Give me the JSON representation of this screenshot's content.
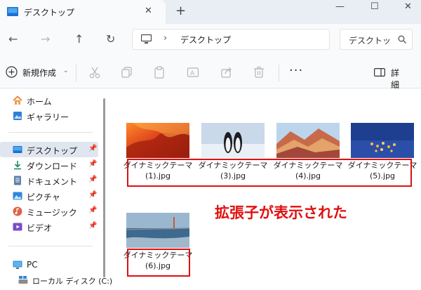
{
  "tab": {
    "title": "デスクトップ",
    "close": "✕",
    "add": "+"
  },
  "window_controls": {
    "minimize": "—",
    "maximize": "☐",
    "close": "✕"
  },
  "nav": {
    "back": "←",
    "forward": "→",
    "up": "↑",
    "refresh": "↻"
  },
  "address": {
    "separator": "›",
    "path": "デスクトップ"
  },
  "search": {
    "placeholder": "デスクトッ"
  },
  "toolbar": {
    "new_label": "新規作成",
    "new_caret": "⌄",
    "more": "···",
    "details_label": "詳細"
  },
  "sidebar": {
    "items": [
      {
        "label": "ホーム",
        "icon": "home-icon"
      },
      {
        "label": "ギャラリー",
        "icon": "gallery-icon"
      },
      {
        "label": "デスクトップ",
        "icon": "desktop-icon",
        "pinned": true,
        "selected": true
      },
      {
        "label": "ダウンロード",
        "icon": "download-icon",
        "pinned": true
      },
      {
        "label": "ドキュメント",
        "icon": "document-icon",
        "pinned": true
      },
      {
        "label": "ピクチャ",
        "icon": "pictures-icon",
        "pinned": true
      },
      {
        "label": "ミュージック",
        "icon": "music-icon",
        "pinned": true
      },
      {
        "label": "ビデオ",
        "icon": "video-icon",
        "pinned": true
      },
      {
        "label": "PC",
        "icon": "pc-icon"
      },
      {
        "label": "ローカル ディスク (C:)",
        "icon": "drive-icon"
      }
    ],
    "pin_glyph": "📌"
  },
  "files": [
    {
      "line1": "ダイナミックテーマ",
      "line2": "(1).jpg"
    },
    {
      "line1": "ダイナミックテーマ",
      "line2": "(3).jpg"
    },
    {
      "line1": "ダイナミックテーマ",
      "line2": "(4).jpg"
    },
    {
      "line1": "ダイナミックテーマ",
      "line2": "(5).jpg"
    },
    {
      "line1": "ダイナミックテーマ",
      "line2": "(6).jpg"
    }
  ],
  "annotation": "拡張子が表示された",
  "colors": {
    "highlight": "#e01010",
    "selected_bg": "#dfe6ef",
    "chrome_bg": "#f9fafc",
    "tabbar_bg": "#e9eef4"
  }
}
